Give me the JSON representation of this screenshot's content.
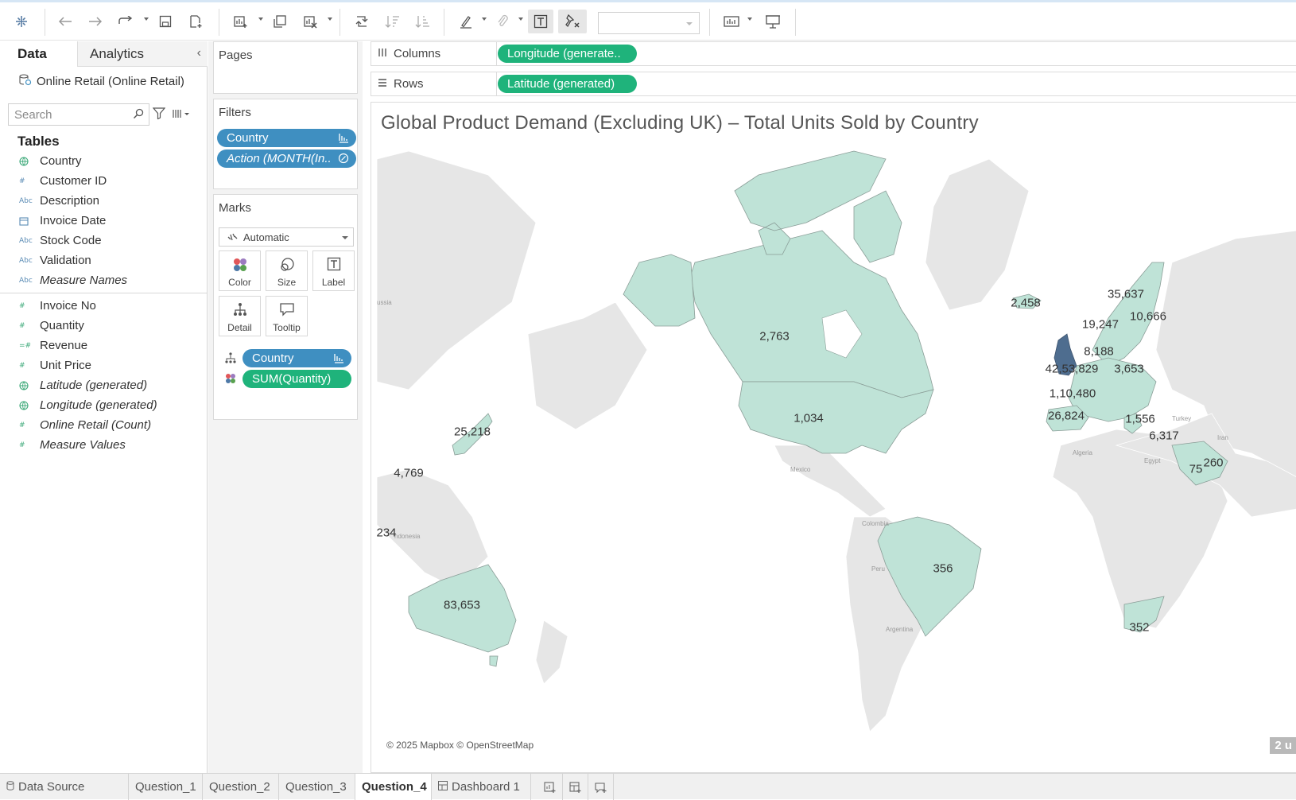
{
  "data_pane": {
    "tab_data": "Data",
    "tab_analytics": "Analytics",
    "datasource": "Online Retail (Online Retail)",
    "search_placeholder": "Search",
    "tables_heading": "Tables",
    "dimensions": [
      {
        "icon": "globe",
        "label": "Country",
        "italic": false
      },
      {
        "icon": "#",
        "label": "Customer ID",
        "italic": false
      },
      {
        "icon": "Abc",
        "label": "Description",
        "italic": false
      },
      {
        "icon": "date",
        "label": "Invoice Date",
        "italic": false
      },
      {
        "icon": "Abc",
        "label": "Stock Code",
        "italic": false
      },
      {
        "icon": "Abc",
        "label": "Validation",
        "italic": false
      },
      {
        "icon": "Abc",
        "label": "Measure Names",
        "italic": true
      }
    ],
    "measures": [
      {
        "icon": "#",
        "label": "Invoice No",
        "italic": false
      },
      {
        "icon": "#",
        "label": "Quantity",
        "italic": false
      },
      {
        "icon": "=#",
        "label": "Revenue",
        "italic": false
      },
      {
        "icon": "#",
        "label": "Unit Price",
        "italic": false
      },
      {
        "icon": "globe",
        "label": "Latitude (generated)",
        "italic": true
      },
      {
        "icon": "globe",
        "label": "Longitude (generated)",
        "italic": true
      },
      {
        "icon": "#",
        "label": "Online Retail (Count)",
        "italic": true
      },
      {
        "icon": "#",
        "label": "Measure Values",
        "italic": true
      }
    ]
  },
  "cards": {
    "pages_title": "Pages",
    "filters_title": "Filters",
    "filters": [
      "Country",
      "Action (MONTH(In.."
    ],
    "marks_title": "Marks",
    "mark_type": "Automatic",
    "mark_buttons": [
      "Color",
      "Size",
      "Label",
      "Detail",
      "Tooltip"
    ],
    "mark_fields": [
      "Country",
      "SUM(Quantity)"
    ]
  },
  "shelves": {
    "columns_label": "Columns",
    "columns_pill": "Longitude (generate..",
    "rows_label": "Rows",
    "rows_pill": "Latitude (generated)"
  },
  "viz": {
    "title": "Global Product Demand (Excluding UK) – Total Units Sold by Country",
    "attribution": "© 2025 Mapbox © OpenStreetMap",
    "badge": "2 u",
    "labels": [
      {
        "text": "2,763",
        "country": "Canada"
      },
      {
        "text": "1,034",
        "country": "USA"
      },
      {
        "text": "356",
        "country": "Brazil"
      },
      {
        "text": "83,653",
        "country": "Australia"
      },
      {
        "text": "25,218",
        "country": "Japan"
      },
      {
        "text": "4,769",
        "country": "Singapore"
      },
      {
        "text": "234",
        "country": "Indonesia"
      },
      {
        "text": "2,458",
        "country": "Iceland"
      },
      {
        "text": "35,637",
        "country": "Sweden"
      },
      {
        "text": "10,666",
        "country": "Finland"
      },
      {
        "text": "19,247",
        "country": "Norway"
      },
      {
        "text": "8,188",
        "country": "Denmark"
      },
      {
        "text": "42,53,829",
        "country": "United Kingdom"
      },
      {
        "text": "3,653",
        "country": "Poland"
      },
      {
        "text": "1,10,480",
        "country": "France"
      },
      {
        "text": "26,824",
        "country": "Spain"
      },
      {
        "text": "1,556",
        "country": "Greece"
      },
      {
        "text": "6,317",
        "country": "Cyprus"
      },
      {
        "text": "75",
        "country": "Saudi Arabia"
      },
      {
        "text": "260",
        "country": "UAE"
      },
      {
        "text": "352",
        "country": "South Africa"
      }
    ],
    "basemap_labels": [
      "ussia",
      "Mexico",
      "Colombia",
      "Peru",
      "Argentina",
      "Algeria",
      "Egypt",
      "Iran",
      "Turkey",
      "ndonesia"
    ]
  },
  "bottom_tabs": [
    "Data Source",
    "Question_1",
    "Question_2",
    "Question_3",
    "Question_4",
    "Dashboard 1"
  ],
  "active_tab": "Question_4",
  "colors": {
    "fill_light": "#bfe3d7",
    "fill_uk": "#4e6d8f",
    "pill_blue": "#3f8fc1",
    "pill_green": "#1fb37b",
    "land_grey": "#e5e5e5"
  }
}
